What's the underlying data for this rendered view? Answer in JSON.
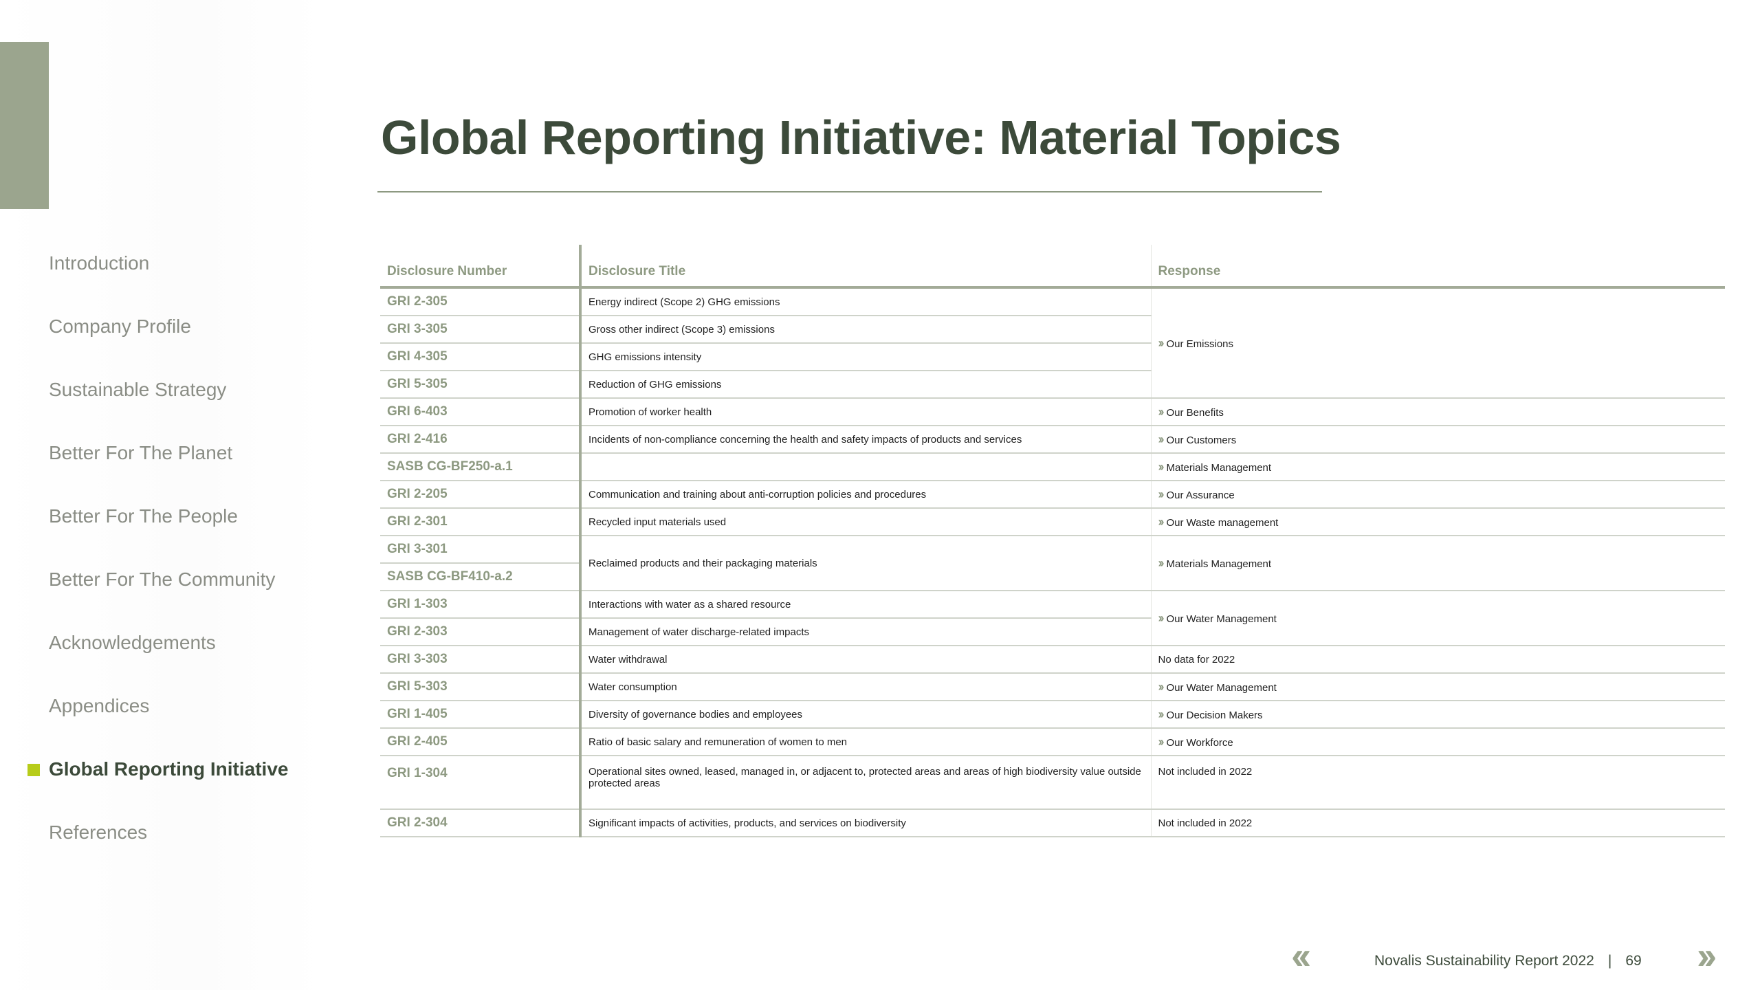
{
  "page": {
    "title": "Global Reporting Initiative: Material Topics"
  },
  "nav": {
    "items": [
      {
        "label": "Introduction"
      },
      {
        "label": "Company Profile"
      },
      {
        "label": "Sustainable Strategy"
      },
      {
        "label": "Better For The Planet"
      },
      {
        "label": "Better For The People"
      },
      {
        "label": "Better For The Community"
      },
      {
        "label": "Acknowledgements"
      },
      {
        "label": "Appendices"
      },
      {
        "label": "Global Reporting Initiative"
      },
      {
        "label": "References"
      }
    ],
    "active_label": "Global Reporting Initiative"
  },
  "table": {
    "headers": [
      "Disclosure Number",
      "Disclosure Title",
      "Response"
    ],
    "rows": [
      {
        "num": "GRI 2-305",
        "title": "Energy indirect (Scope 2) GHG emissions"
      },
      {
        "num": "GRI 3-305",
        "title": "Gross other indirect (Scope 3) emissions"
      },
      {
        "num": "GRI 4-305",
        "title": "GHG emissions intensity"
      },
      {
        "num": "GRI 5-305",
        "title": "Reduction of GHG emissions"
      },
      {
        "num": "GRI 6-403",
        "title": "Promotion of worker health",
        "response": "Our Benefits"
      },
      {
        "num": "GRI 2-416",
        "title": "Incidents of non-compliance concerning the health and safety impacts of products and services",
        "response": "Our Customers"
      },
      {
        "num": "SASB CG-BF250-a.1",
        "title": "",
        "response": "Materials Management"
      },
      {
        "num": "GRI 2-205",
        "title": "Communication and training about anti-corruption policies and procedures",
        "response": "Our Assurance"
      },
      {
        "num": "GRI 2-301",
        "title": "Recycled input materials used",
        "response": "Our Waste management"
      },
      {
        "num": "GRI 3-301",
        "title": "Reclaimed products and their packaging materials",
        "response": "Materials Management"
      },
      {
        "num": "SASB CG-BF410-a.2"
      },
      {
        "num": "GRI 1-303",
        "title": "Interactions with water as a shared resource",
        "response": "Our Water Management"
      },
      {
        "num": "GRI 2-303",
        "title": "Management of water discharge-related impacts"
      },
      {
        "num": "GRI 3-303",
        "title": "Water withdrawal",
        "response": "No data for 2022"
      },
      {
        "num": "GRI 5-303",
        "title": "Water consumption",
        "response": "Our Water Management"
      },
      {
        "num": "GRI 1-405",
        "title": "Diversity of governance bodies and employees",
        "response": "Our Decision Makers"
      },
      {
        "num": "GRI 2-405",
        "title": "Ratio of basic salary and remuneration of women to men",
        "response": "Our Workforce"
      },
      {
        "num": "GRI 1-304",
        "title": "Operational sites owned, leased, managed in, or adjacent to, protected areas and areas of high biodiversity value outside protected areas",
        "response": "Not included in 2022"
      },
      {
        "num": "GRI 2-304",
        "title": "Significant impacts of activities, products, and services on biodiversity",
        "response": "Not included in 2022"
      }
    ],
    "group_responses": {
      "emissions": "Our Emissions"
    }
  },
  "footer": {
    "report": "Novalis Sustainability Report 2022",
    "separator": "|",
    "page_number": "69",
    "prev_icon": "double-chevron-left-icon",
    "next_icon": "double-chevron-right-icon"
  },
  "colors": {
    "accent": "#9ba58e",
    "title": "#3c4a3a",
    "marker": "#b7cc1a",
    "muted": "#8d9981"
  }
}
